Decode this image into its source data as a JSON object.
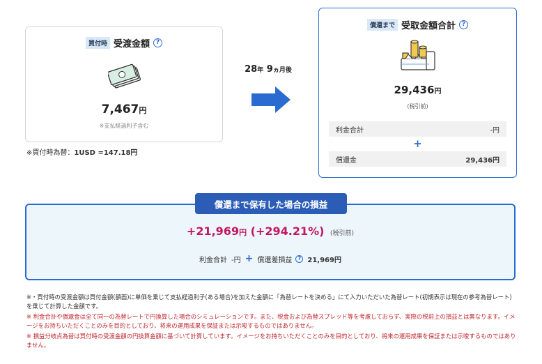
{
  "left_card": {
    "tag": "買付時",
    "title": "受渡金額",
    "help": "?",
    "amount": "7,467",
    "unit": "円",
    "note": "※支払経過利子含む"
  },
  "fx_note": {
    "prefix": "※買付時為替：",
    "rate": "1USD =147.18円"
  },
  "duration": {
    "years": "28",
    "years_unit": "年",
    "months": "9",
    "months_unit": "ヵ月後"
  },
  "right_card": {
    "tag": "償還まで",
    "title": "受取金額合計",
    "help": "?",
    "amount": "29,436",
    "unit": "円",
    "tax_note": "(税引前)",
    "interest_label": "利金合計",
    "interest_value": "-円",
    "plus": "+",
    "redemption_label": "償還金",
    "redemption_value": "29,436円"
  },
  "result": {
    "title": "償還まで保有した場合の損益",
    "profit": "+21,969",
    "profit_unit": "円",
    "percent": "(+294.21%)",
    "tax_note": "(税引前)",
    "interest_label": "利金合計",
    "interest_value": "-円",
    "plus": "+",
    "fx_label": "償還差損益",
    "help": "?",
    "fx_value": "21,969円"
  },
  "notes": [
    "※・買付時の受渡金額は買付金額(額面)に単価を乗じて支払経過利子(ある場合)を加えた金額に「為替レートを決める」にて入力いただいた為替レート(初期表示は現在の参考為替レート)を乗じて計算した金額です。",
    "※ 利金合計や償還金は全て同一の為替レートで円換算した場合のシミュレーションです。また、税金および為替スプレッド等を考慮しておらず、実際の税前上の損益とは異なります。イメージをお持ちいただくことのみを目的としており、将来の運用成果を保証または示唆するものではありません。",
    "※ 損益分岐点為替は買付時の受渡金額の円換算金額に基づいて計算しています。イメージをお持ちいただくことのみを目的としており、将来の運用成果を保証または示唆するものではありません。"
  ],
  "colors": {
    "accent": "#2a6bd1",
    "title_bar": "#2b5cb6",
    "profit": "#c3185e",
    "warning": "#c0262d",
    "result_bg": "#edf6fb"
  }
}
